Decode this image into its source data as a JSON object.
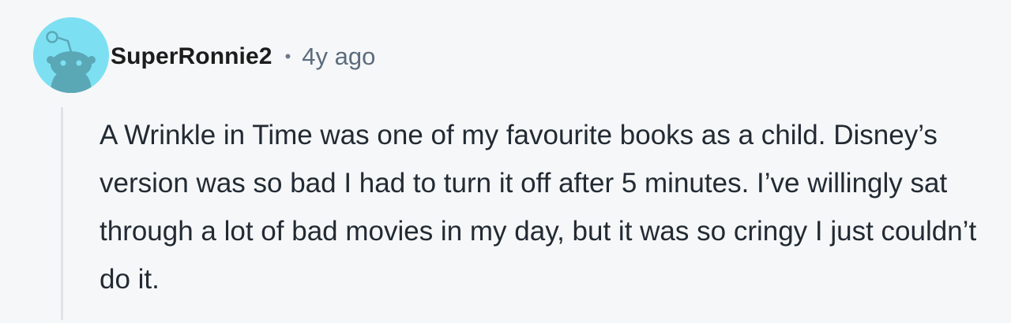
{
  "comment": {
    "author": "SuperRonnie2",
    "separator": "•",
    "timestamp": "4y ago",
    "body": "A Wrinkle in Time was one of my favourite books as a child. Disney’s version was so bad I had to turn it off after 5 minutes. I’ve willingly sat through a lot of bad movies in my day, but it was so cringy I just couldn’t do it.",
    "avatar_icon": "snoo-avatar-icon",
    "avatar_color": "#7de0f2"
  }
}
